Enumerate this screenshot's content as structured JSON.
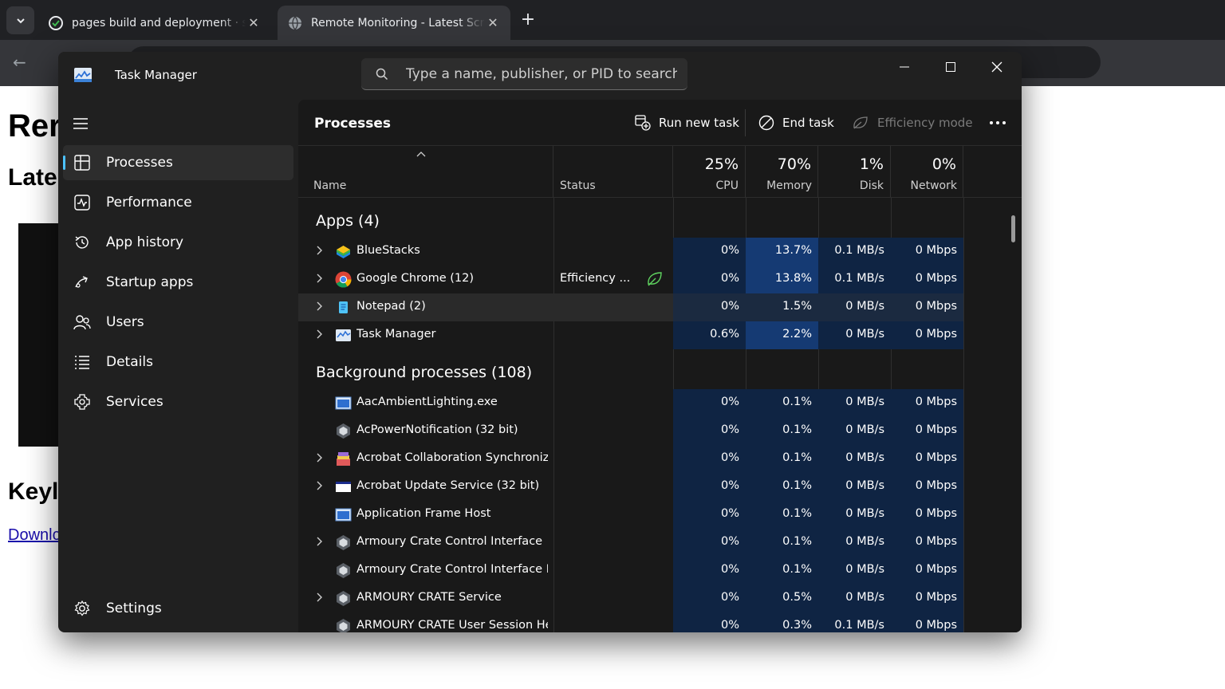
{
  "browser": {
    "tabs": [
      {
        "title": "pages build and deployment · s",
        "icon": "github-icon"
      },
      {
        "title": "Remote Monitoring - Latest Scr",
        "icon": "globe-icon"
      }
    ],
    "new_tab": "+"
  },
  "webpage": {
    "heading": "Rer",
    "subheading": "Late",
    "section2": "Keyl",
    "link": "Downlc"
  },
  "taskmanager": {
    "title": "Task Manager",
    "search_placeholder": "Type a name, publisher, or PID to search",
    "nav": [
      {
        "label": "Processes",
        "icon": "processes-icon",
        "active": true
      },
      {
        "label": "Performance",
        "icon": "performance-icon"
      },
      {
        "label": "App history",
        "icon": "app-history-icon"
      },
      {
        "label": "Startup apps",
        "icon": "startup-apps-icon"
      },
      {
        "label": "Users",
        "icon": "users-icon"
      },
      {
        "label": "Details",
        "icon": "details-icon"
      },
      {
        "label": "Services",
        "icon": "services-icon"
      }
    ],
    "settings_label": "Settings",
    "page_title": "Processes",
    "commands": {
      "run_new_task": "Run new task",
      "end_task": "End task",
      "efficiency_mode": "Efficiency mode"
    },
    "columns": {
      "name": "Name",
      "status": "Status",
      "cpu_pct": "25%",
      "cpu": "CPU",
      "mem_pct": "70%",
      "mem": "Memory",
      "disk_pct": "1%",
      "disk": "Disk",
      "net_pct": "0%",
      "net": "Network"
    },
    "apps_group": "Apps (4)",
    "apps": [
      {
        "name": "BlueStacks",
        "status": "",
        "cpu": "0%",
        "mem": "13.7%",
        "disk": "0.1 MB/s",
        "net": "0 Mbps"
      },
      {
        "name": "Google Chrome (12)",
        "status": "Efficiency ...",
        "cpu": "0%",
        "mem": "13.8%",
        "disk": "0.1 MB/s",
        "net": "0 Mbps"
      },
      {
        "name": "Notepad (2)",
        "status": "",
        "cpu": "0%",
        "mem": "1.5%",
        "disk": "0 MB/s",
        "net": "0 Mbps"
      },
      {
        "name": "Task Manager",
        "status": "",
        "cpu": "0.6%",
        "mem": "2.2%",
        "disk": "0 MB/s",
        "net": "0 Mbps"
      }
    ],
    "bg_group": "Background processes (108)",
    "background": [
      {
        "name": "AacAmbientLighting.exe",
        "cpu": "0%",
        "mem": "0.1%",
        "disk": "0 MB/s",
        "net": "0 Mbps"
      },
      {
        "name": "AcPowerNotification (32 bit)",
        "cpu": "0%",
        "mem": "0.1%",
        "disk": "0 MB/s",
        "net": "0 Mbps"
      },
      {
        "name": "Acrobat Collaboration Synchroniz...",
        "cpu": "0%",
        "mem": "0.1%",
        "disk": "0 MB/s",
        "net": "0 Mbps"
      },
      {
        "name": "Acrobat Update Service (32 bit)",
        "cpu": "0%",
        "mem": "0.1%",
        "disk": "0 MB/s",
        "net": "0 Mbps"
      },
      {
        "name": "Application Frame Host",
        "cpu": "0%",
        "mem": "0.1%",
        "disk": "0 MB/s",
        "net": "0 Mbps"
      },
      {
        "name": "Armoury Crate Control Interface",
        "cpu": "0%",
        "mem": "0.1%",
        "disk": "0 MB/s",
        "net": "0 Mbps"
      },
      {
        "name": "Armoury Crate Control Interface M...",
        "cpu": "0%",
        "mem": "0.1%",
        "disk": "0 MB/s",
        "net": "0 Mbps"
      },
      {
        "name": "ARMOURY CRATE Service",
        "cpu": "0%",
        "mem": "0.5%",
        "disk": "0 MB/s",
        "net": "0 Mbps"
      },
      {
        "name": "ARMOURY CRATE User Session Hel...",
        "cpu": "0%",
        "mem": "0.3%",
        "disk": "0.1 MB/s",
        "net": "0 Mbps"
      }
    ]
  }
}
